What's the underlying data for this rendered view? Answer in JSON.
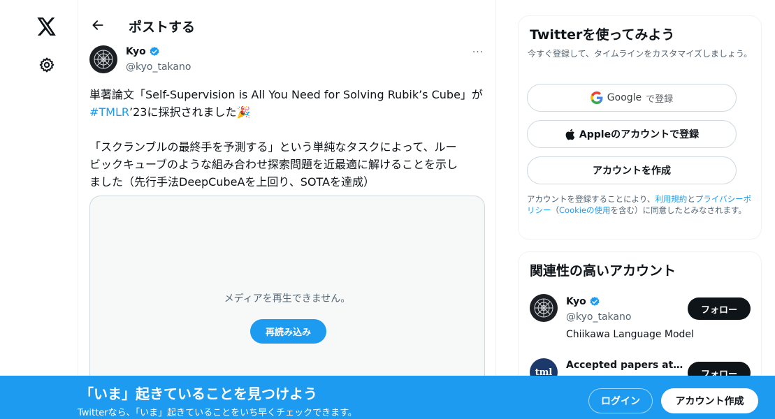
{
  "nav": {
    "logo_icon": "x-logo-icon",
    "settings_icon": "gear-icon"
  },
  "header": {
    "back_icon": "arrow-left-icon",
    "title": "ポストする"
  },
  "tweet": {
    "author_name": "Kyo",
    "author_handle": "@kyo_takano",
    "verified": true,
    "more_icon": "more-icon",
    "more_label": "···",
    "line1": "単著論文「Self-Supervision is All You Need for Solving Rubik’s Cube」が",
    "hashtag": "#TMLR",
    "line2_rest": "’23に採択されました🎉",
    "para2_line1": "「スクランブルの最終手を予測する」という単純なタスクによって、ルー",
    "para2_line2": "ビックキューブのような組み合わせ探索問題を近最適に解けることを示し",
    "para2_line3": "ました（先行手法DeepCubeAを上回り、SOTAを達成）",
    "media_message": "メディアを再生できません。",
    "reload_label": "再読み込み"
  },
  "signup": {
    "title": "Twitterを使ってみよう",
    "subtitle": "今すぐ登録して、タイムラインをカスタマイズしましょう。",
    "google_label": "Google",
    "google_suffix": "で登録",
    "apple_label": "Appleのアカウントで登録",
    "create_label": "アカウントを作成",
    "terms_prefix": "アカウントを登録することにより、",
    "terms_link": "利用規約",
    "terms_and": "と",
    "privacy_link": "プライバシーポリシー",
    "terms_paren_open": "（",
    "cookie_link": "Cookieの使用",
    "terms_suffix": "を含む）に同意したとみなされます。"
  },
  "related": {
    "title": "関連性の高いアカウント",
    "accounts": [
      {
        "name": "Kyo",
        "handle": "@kyo_takano",
        "bio": "Chiikawa Language Model",
        "verified": true,
        "follow_label": "フォロー"
      },
      {
        "name": "Accepted papers at TMLR",
        "avatar_text": "tml",
        "follow_label": "フォロー"
      }
    ]
  },
  "banner": {
    "title": "「いま」起きていることを見つけよう",
    "subtitle": "Twitterなら、「いま」起きていることをいち早くチェックできます。",
    "login_label": "ログイン",
    "create_label": "アカウント作成"
  },
  "colors": {
    "accent": "#1d9bf0",
    "text": "#0f1419",
    "muted": "#536471",
    "border": "#cfd9de"
  }
}
